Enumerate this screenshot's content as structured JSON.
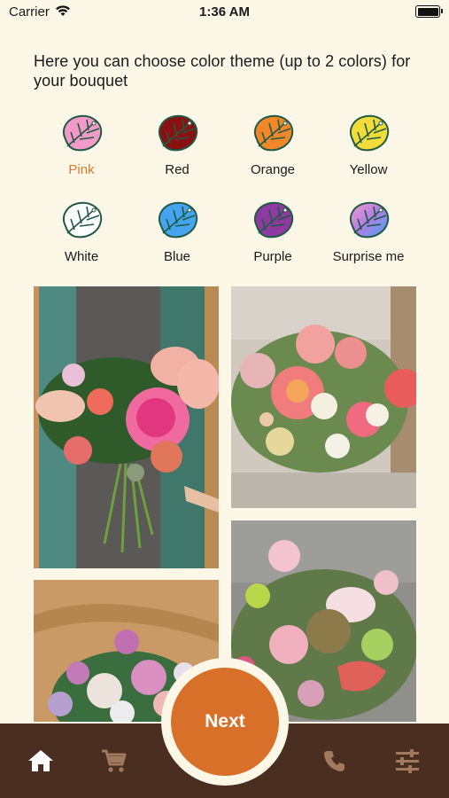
{
  "status": {
    "carrier": "Carrier",
    "time": "1:36 AM"
  },
  "intro": "Here you can choose color theme (up to 2 colors) for your bouquet",
  "themes": [
    {
      "label": "Pink",
      "color": "#f49ac9",
      "selected": true
    },
    {
      "label": "Red",
      "color": "#8b1010"
    },
    {
      "label": "Orange",
      "color": "#f2872a"
    },
    {
      "label": "Yellow",
      "color": "#f2dc3a"
    },
    {
      "label": "White",
      "color": "#ffffff"
    },
    {
      "label": "Blue",
      "color": "#44a4f0"
    },
    {
      "label": "Purple",
      "color": "#8e3aa0"
    },
    {
      "label": "Surprise me",
      "color": "gradient"
    }
  ],
  "next_label": "Next",
  "colors": {
    "accent": "#d9702a",
    "tabbar": "#4a2e1f",
    "background": "#fdf7e8",
    "selected_label": "#d97a2e"
  },
  "tabs": [
    "home-icon",
    "cart-icon",
    "phone-icon",
    "sliders-icon"
  ]
}
